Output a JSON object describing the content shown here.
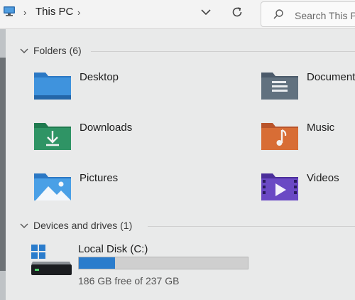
{
  "address_bar": {
    "location_icon": "this-pc-icon",
    "title": "This PC",
    "separator": "›",
    "search": {
      "placeholder": "Search This PC"
    }
  },
  "folders_section": {
    "title": "Folders (6)",
    "items": [
      {
        "label": "Desktop",
        "icon": "desktop-folder-icon"
      },
      {
        "label": "Documents",
        "icon": "documents-folder-icon"
      },
      {
        "label": "Downloads",
        "icon": "downloads-folder-icon"
      },
      {
        "label": "Music",
        "icon": "music-folder-icon"
      },
      {
        "label": "Pictures",
        "icon": "pictures-folder-icon"
      },
      {
        "label": "Videos",
        "icon": "videos-folder-icon"
      }
    ]
  },
  "drives_section": {
    "title": "Devices and drives (1)",
    "drives": [
      {
        "label": "Local Disk (C:)",
        "free_text": "186 GB free of 237 GB",
        "used_fraction": 0.215,
        "bar_color": "#2a7ccc"
      }
    ]
  },
  "colors": {
    "background": "#e9eaea",
    "accent": "#2a7ccc"
  }
}
